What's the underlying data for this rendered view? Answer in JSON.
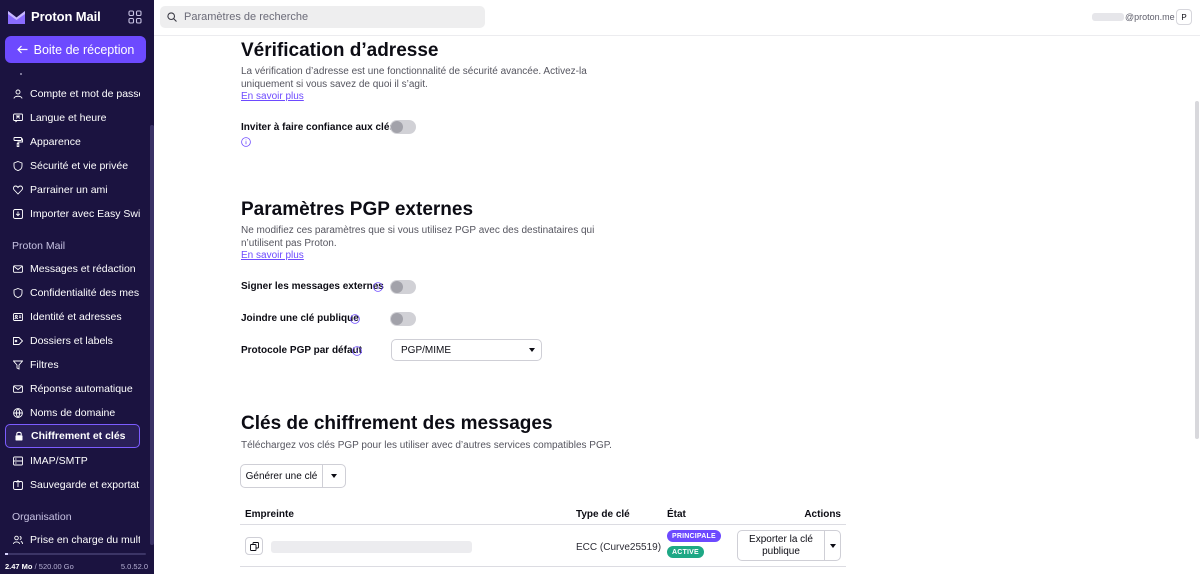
{
  "app": {
    "name": "Proton Mail"
  },
  "sidebar": {
    "inbox_button": "Boite de réception",
    "account_items": [
      {
        "label": "Compte et mot de passe",
        "icon": "user-icon"
      },
      {
        "label": "Langue et heure",
        "icon": "language-icon"
      },
      {
        "label": "Apparence",
        "icon": "paint-roller-icon"
      },
      {
        "label": "Sécurité et vie privée",
        "icon": "shield-icon"
      },
      {
        "label": "Parrainer un ami",
        "icon": "heart-icon"
      },
      {
        "label": "Importer avec Easy Swi...",
        "icon": "import-icon"
      }
    ],
    "mail_section_title": "Proton Mail",
    "mail_items": [
      {
        "label": "Messages et rédaction",
        "icon": "envelope-icon"
      },
      {
        "label": "Confidentialité des mes...",
        "icon": "shield-icon"
      },
      {
        "label": "Identité et adresses",
        "icon": "id-card-icon"
      },
      {
        "label": "Dossiers et labels",
        "icon": "tags-icon"
      },
      {
        "label": "Filtres",
        "icon": "filter-icon"
      },
      {
        "label": "Réponse automatique",
        "icon": "envelope-arrow-icon"
      },
      {
        "label": "Noms de domaine",
        "icon": "globe-icon"
      },
      {
        "label": "Chiffrement et clés",
        "icon": "lock-icon",
        "active": true
      },
      {
        "label": "IMAP/SMTP",
        "icon": "servers-icon"
      },
      {
        "label": "Sauvegarde et exportat...",
        "icon": "export-icon"
      }
    ],
    "org_section_title": "Organisation",
    "org_items": [
      {
        "label": "Prise en charge du mult...",
        "icon": "users-icon"
      }
    ],
    "storage": {
      "used": "2.47 Mo",
      "separator": " / ",
      "total": "520.00 Go",
      "fraction_used": 4.6e-06
    },
    "version": "5.0.52.0"
  },
  "topbar": {
    "search_placeholder": "Paramètres de recherche",
    "account_email_suffix": "@proton.me",
    "avatar_initial": "P"
  },
  "address_verification": {
    "title": "Vérification d’adresse",
    "description": "La vérification d’adresse est une fonctionnalité de sécurité avancée. Activez-la uniquement si vous savez de quoi il s’agit.",
    "learn_more": "En savoir plus",
    "trust_keys_label": "Inviter à faire confiance aux clés",
    "trust_keys_enabled": false
  },
  "external_pgp": {
    "title": "Paramètres PGP externes",
    "description": "Ne modifiez ces paramètres que si vous utilisez PGP avec des destinataires qui n’utilisent pas Proton.",
    "learn_more": "En savoir plus",
    "sign_label": "Signer les messages externes",
    "sign_enabled": false,
    "attach_label": "Joindre une clé publique",
    "attach_enabled": false,
    "scheme_label": "Protocole PGP par défaut",
    "scheme_value": "PGP/MIME"
  },
  "message_keys": {
    "title": "Clés de chiffrement des messages",
    "description": "Téléchargez vos clés PGP pour les utiliser avec d’autres services compatibles PGP.",
    "generate_button": "Générer une clé",
    "columns": {
      "fingerprint": "Empreinte",
      "key_type": "Type de clé",
      "status": "État",
      "actions": "Actions"
    },
    "rows": [
      {
        "key_type": "ECC (Curve25519)",
        "badges": [
          "PRINCIPALE",
          "ACTIVE"
        ],
        "action": "Exporter la clé publique"
      }
    ]
  },
  "colors": {
    "sidebar_bg": "#1b1340",
    "accent": "#6d4aff",
    "active_badge": "#1ea885"
  }
}
